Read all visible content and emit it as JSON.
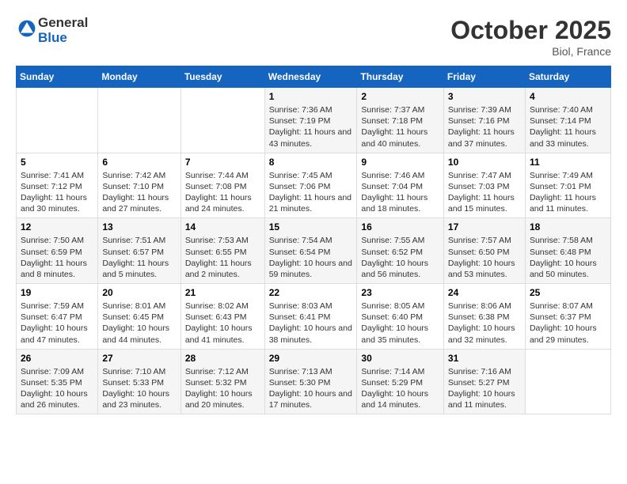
{
  "header": {
    "logo_general": "General",
    "logo_blue": "Blue",
    "month": "October 2025",
    "location": "Biol, France"
  },
  "days_of_week": [
    "Sunday",
    "Monday",
    "Tuesday",
    "Wednesday",
    "Thursday",
    "Friday",
    "Saturday"
  ],
  "weeks": [
    [
      {
        "day": "",
        "content": ""
      },
      {
        "day": "",
        "content": ""
      },
      {
        "day": "",
        "content": ""
      },
      {
        "day": "1",
        "content": "Sunrise: 7:36 AM\nSunset: 7:19 PM\nDaylight: 11 hours and 43 minutes."
      },
      {
        "day": "2",
        "content": "Sunrise: 7:37 AM\nSunset: 7:18 PM\nDaylight: 11 hours and 40 minutes."
      },
      {
        "day": "3",
        "content": "Sunrise: 7:39 AM\nSunset: 7:16 PM\nDaylight: 11 hours and 37 minutes."
      },
      {
        "day": "4",
        "content": "Sunrise: 7:40 AM\nSunset: 7:14 PM\nDaylight: 11 hours and 33 minutes."
      }
    ],
    [
      {
        "day": "5",
        "content": "Sunrise: 7:41 AM\nSunset: 7:12 PM\nDaylight: 11 hours and 30 minutes."
      },
      {
        "day": "6",
        "content": "Sunrise: 7:42 AM\nSunset: 7:10 PM\nDaylight: 11 hours and 27 minutes."
      },
      {
        "day": "7",
        "content": "Sunrise: 7:44 AM\nSunset: 7:08 PM\nDaylight: 11 hours and 24 minutes."
      },
      {
        "day": "8",
        "content": "Sunrise: 7:45 AM\nSunset: 7:06 PM\nDaylight: 11 hours and 21 minutes."
      },
      {
        "day": "9",
        "content": "Sunrise: 7:46 AM\nSunset: 7:04 PM\nDaylight: 11 hours and 18 minutes."
      },
      {
        "day": "10",
        "content": "Sunrise: 7:47 AM\nSunset: 7:03 PM\nDaylight: 11 hours and 15 minutes."
      },
      {
        "day": "11",
        "content": "Sunrise: 7:49 AM\nSunset: 7:01 PM\nDaylight: 11 hours and 11 minutes."
      }
    ],
    [
      {
        "day": "12",
        "content": "Sunrise: 7:50 AM\nSunset: 6:59 PM\nDaylight: 11 hours and 8 minutes."
      },
      {
        "day": "13",
        "content": "Sunrise: 7:51 AM\nSunset: 6:57 PM\nDaylight: 11 hours and 5 minutes."
      },
      {
        "day": "14",
        "content": "Sunrise: 7:53 AM\nSunset: 6:55 PM\nDaylight: 11 hours and 2 minutes."
      },
      {
        "day": "15",
        "content": "Sunrise: 7:54 AM\nSunset: 6:54 PM\nDaylight: 10 hours and 59 minutes."
      },
      {
        "day": "16",
        "content": "Sunrise: 7:55 AM\nSunset: 6:52 PM\nDaylight: 10 hours and 56 minutes."
      },
      {
        "day": "17",
        "content": "Sunrise: 7:57 AM\nSunset: 6:50 PM\nDaylight: 10 hours and 53 minutes."
      },
      {
        "day": "18",
        "content": "Sunrise: 7:58 AM\nSunset: 6:48 PM\nDaylight: 10 hours and 50 minutes."
      }
    ],
    [
      {
        "day": "19",
        "content": "Sunrise: 7:59 AM\nSunset: 6:47 PM\nDaylight: 10 hours and 47 minutes."
      },
      {
        "day": "20",
        "content": "Sunrise: 8:01 AM\nSunset: 6:45 PM\nDaylight: 10 hours and 44 minutes."
      },
      {
        "day": "21",
        "content": "Sunrise: 8:02 AM\nSunset: 6:43 PM\nDaylight: 10 hours and 41 minutes."
      },
      {
        "day": "22",
        "content": "Sunrise: 8:03 AM\nSunset: 6:41 PM\nDaylight: 10 hours and 38 minutes."
      },
      {
        "day": "23",
        "content": "Sunrise: 8:05 AM\nSunset: 6:40 PM\nDaylight: 10 hours and 35 minutes."
      },
      {
        "day": "24",
        "content": "Sunrise: 8:06 AM\nSunset: 6:38 PM\nDaylight: 10 hours and 32 minutes."
      },
      {
        "day": "25",
        "content": "Sunrise: 8:07 AM\nSunset: 6:37 PM\nDaylight: 10 hours and 29 minutes."
      }
    ],
    [
      {
        "day": "26",
        "content": "Sunrise: 7:09 AM\nSunset: 5:35 PM\nDaylight: 10 hours and 26 minutes."
      },
      {
        "day": "27",
        "content": "Sunrise: 7:10 AM\nSunset: 5:33 PM\nDaylight: 10 hours and 23 minutes."
      },
      {
        "day": "28",
        "content": "Sunrise: 7:12 AM\nSunset: 5:32 PM\nDaylight: 10 hours and 20 minutes."
      },
      {
        "day": "29",
        "content": "Sunrise: 7:13 AM\nSunset: 5:30 PM\nDaylight: 10 hours and 17 minutes."
      },
      {
        "day": "30",
        "content": "Sunrise: 7:14 AM\nSunset: 5:29 PM\nDaylight: 10 hours and 14 minutes."
      },
      {
        "day": "31",
        "content": "Sunrise: 7:16 AM\nSunset: 5:27 PM\nDaylight: 10 hours and 11 minutes."
      },
      {
        "day": "",
        "content": ""
      }
    ]
  ]
}
